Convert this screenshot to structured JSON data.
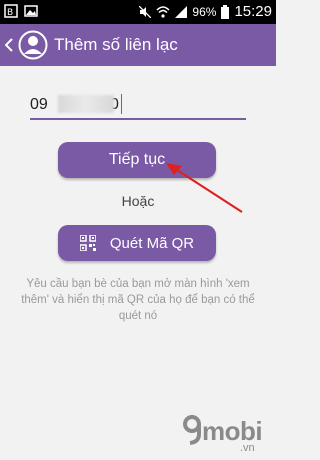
{
  "status_bar": {
    "battery_percent": "96%",
    "time": "15:29"
  },
  "app_bar": {
    "title": "Thêm số liên lạc"
  },
  "form": {
    "phone_prefix": "09",
    "phone_suffix": "0"
  },
  "actions": {
    "continue_label": "Tiếp tục",
    "or_label": "Hoặc",
    "scan_qr_label": "Quét Mã QR"
  },
  "help": {
    "text": "Yêu cầu bạn bè của bạn mở màn hình 'xem thêm' và hiển thị mã QR của họ để bạn có thể quét nó"
  },
  "watermark": {
    "brand": "mobi",
    "domain": ".vn"
  },
  "colors": {
    "accent": "#7a5aa5",
    "annotation_arrow": "#e02020"
  },
  "icons": {
    "back": "chevron-left-icon",
    "avatar": "contact-avatar-icon",
    "qr": "qr-code-icon"
  }
}
